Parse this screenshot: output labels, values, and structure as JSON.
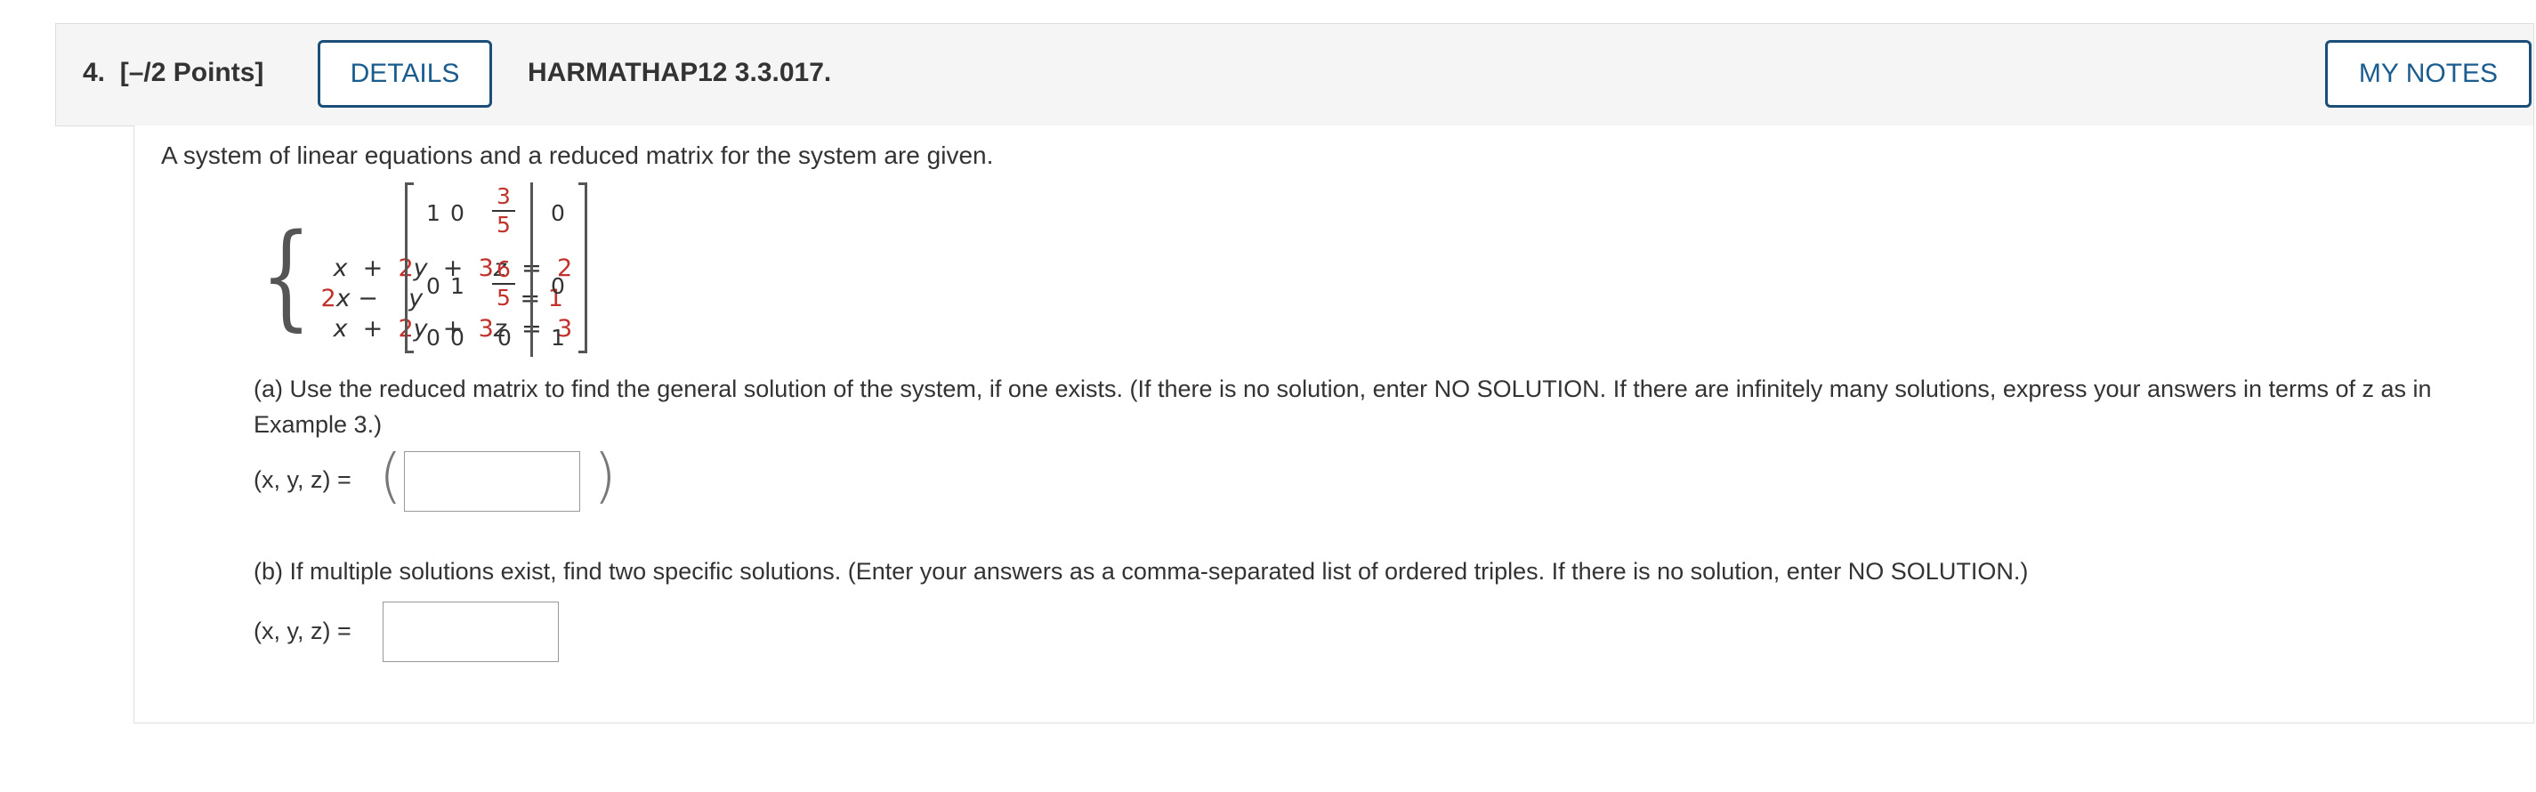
{
  "header": {
    "question_number": "4.",
    "points": "[–/2 Points]",
    "details_label": "DETAILS",
    "question_code": "HARMATHAP12 3.3.017.",
    "my_notes_label": "MY NOTES"
  },
  "intro": "A system of linear equations and a reduced matrix for the system are given.",
  "system": {
    "row1": {
      "t1": "x",
      "op1": "+",
      "t2c": "2",
      "t2v": "y",
      "op2": "+",
      "t3c": "3",
      "t3v": "z",
      "eq": "=",
      "rhs": "2"
    },
    "row2": {
      "t1c": "2",
      "t1v": "x",
      "op1": "−",
      "t2v": "y",
      "eq": "=",
      "rhs": "1"
    },
    "row3": {
      "t1": "x",
      "op1": "+",
      "t2c": "2",
      "t2v": "y",
      "op2": "+",
      "t3c": "3",
      "t3v": "z",
      "eq": "=",
      "rhs": "3"
    }
  },
  "matrix": {
    "r1": [
      "1",
      "0",
      "3",
      "5",
      "0"
    ],
    "r2": [
      "0",
      "1",
      "6",
      "5",
      "0"
    ],
    "r3": [
      "0",
      "0",
      "0",
      "1"
    ]
  },
  "part_a": {
    "text": "(a) Use the reduced matrix to find the general solution of the system, if one exists. (If there is no solution, enter NO SOLUTION. If there are infinitely many solutions, express your answers in terms of z as in Example 3.)",
    "label": "(x, y, z) =",
    "open_paren": "(",
    "close_paren": ")",
    "answer_value": ""
  },
  "part_b": {
    "text": "(b) If multiple solutions exist, find two specific solutions. (Enter your answers as a comma-separated list of ordered triples. If there is no solution, enter NO SOLUTION.)",
    "label": "(x, y, z) =",
    "answer_value": ""
  },
  "colors": {
    "accent": "#1b5c8f",
    "highlight": "#c0322b"
  }
}
